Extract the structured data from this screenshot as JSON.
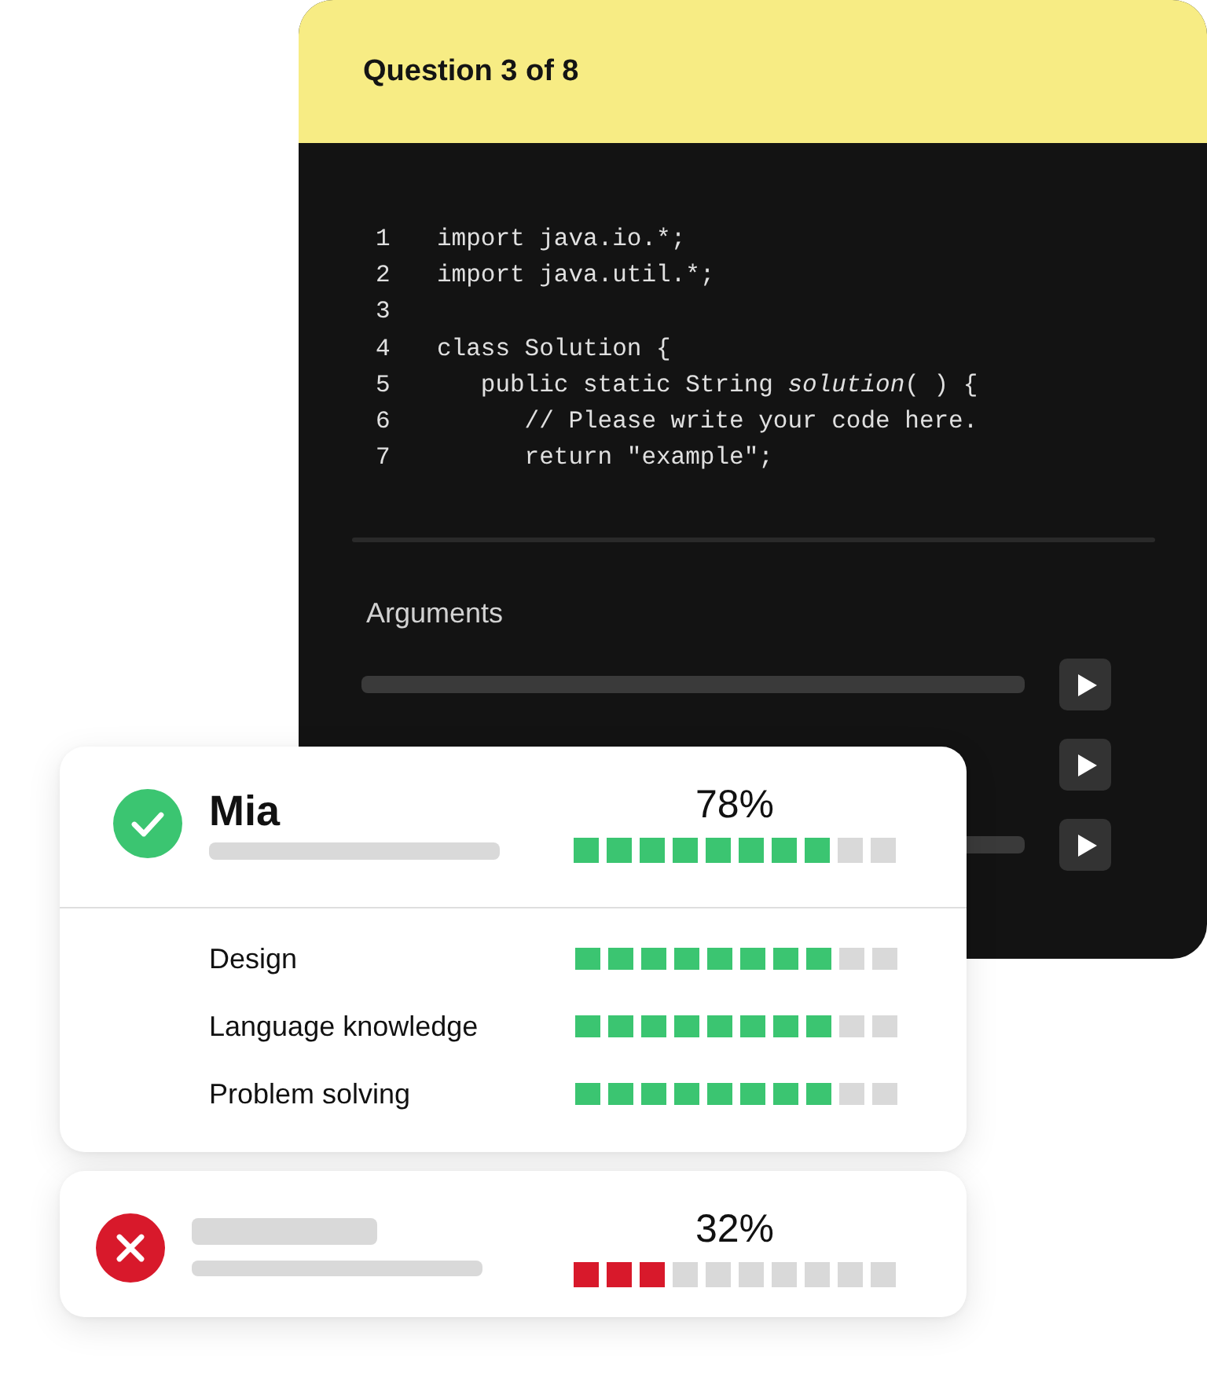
{
  "question_panel": {
    "title": "Question 3 of 8",
    "code_lines": [
      {
        "number": "1",
        "text": "import java.io.*;"
      },
      {
        "number": "2",
        "text": "import java.util.*;"
      },
      {
        "number": "3"
      },
      {
        "number": "4",
        "text": "class Solution {",
        "children": [
          {
            "number": "5",
            "text": "public static String *solution*( ) {",
            "children": [
              {
                "number": "6",
                "text": "// Please write your code here."
              },
              {
                "number": "7",
                "text": "return \"example\";"
              }
            ]
          }
        ]
      }
    ],
    "arguments": {
      "label": "Arguments",
      "rows": [
        {
          "kind": "field"
        },
        {
          "kind": "button"
        },
        {
          "kind": "partial_field"
        }
      ]
    }
  },
  "candidates": [
    {
      "passed": true,
      "name": "Mia",
      "score": "78%",
      "level": 0.8,
      "skills": [
        {
          "label": "Design",
          "level": 0.8
        },
        {
          "label": "Language knowledge",
          "level": 0.8
        },
        {
          "label": "Problem solving",
          "level": 0.8
        }
      ]
    },
    {
      "passed": false,
      "score": "32%",
      "level": 0.3
    }
  ]
}
